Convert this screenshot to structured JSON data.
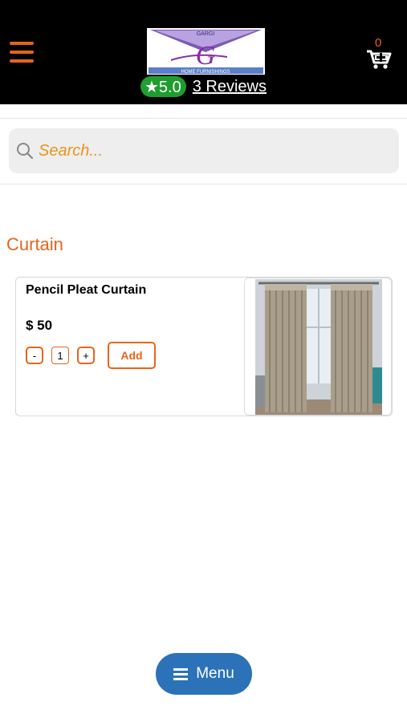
{
  "header": {
    "rating": "★5.0",
    "reviews": "3 Reviews",
    "cart_count": "0",
    "logo": {
      "top_text": "GARGI",
      "letter": "G",
      "bottom_text": "HOME FURNISHINGS"
    }
  },
  "search": {
    "placeholder": "Search..."
  },
  "category": {
    "title": "Curtain"
  },
  "products": [
    {
      "name": "Pencil Pleat Curtain",
      "price": "$ 50",
      "minus": "-",
      "quantity": "1",
      "plus": "+",
      "add_label": "Add"
    }
  ],
  "bottom": {
    "menu_label": "Menu"
  },
  "colors": {
    "header_bg": "#000000",
    "accent": "#e8641b",
    "rating_green": "#1f9d2f",
    "menu_blue": "#2b72b8"
  },
  "icons": [
    "hamburger-icon",
    "cart-icon",
    "search-icon",
    "menu-icon"
  ]
}
